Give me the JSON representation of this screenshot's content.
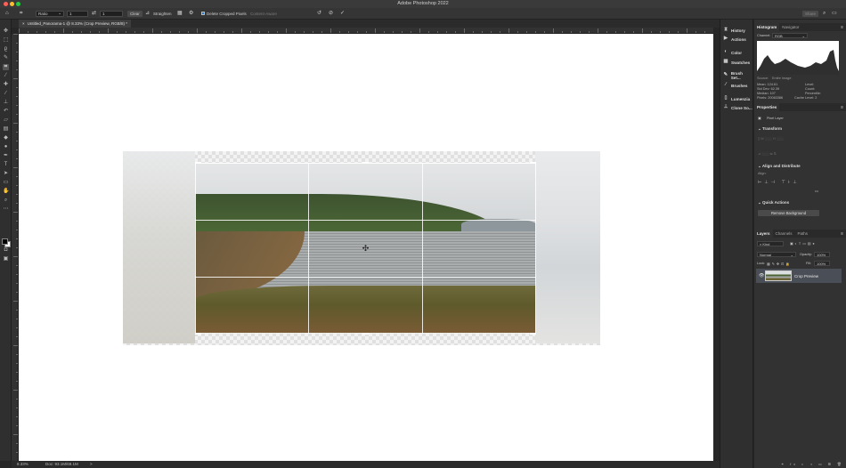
{
  "window": {
    "title": "Adobe Photoshop 2022",
    "traffic_colors": [
      "#fe5f57",
      "#febc2e",
      "#28c840"
    ]
  },
  "options_bar": {
    "ratio_select": "Ratio",
    "width_value": "1",
    "height_value": "1",
    "clear_label": "Clear",
    "straighten_label": "Straighten",
    "delete_cropped_label": "Delete Cropped Pixels",
    "content_aware_label": "Content-Aware",
    "share_label": "Share"
  },
  "document": {
    "tab_title": "Untitled_Panorama-1 @ 8.33% (Crop Preview, RGB/8) *"
  },
  "status": {
    "zoom": "8.33%",
    "doc_size": "Doc: 93.1M/69.1M",
    "arrow": ">"
  },
  "side_icons": {
    "items": [
      {
        "icon": "history-icon",
        "label": "History"
      },
      {
        "icon": "actions-icon",
        "label": "Actions"
      },
      {
        "icon": "color-icon",
        "label": "Color"
      },
      {
        "icon": "swatches-icon",
        "label": "Swatches"
      },
      {
        "icon": "brush-settings-icon",
        "label": "Brush Set..."
      },
      {
        "icon": "brushes-icon",
        "label": "Brushes"
      },
      {
        "icon": "lumenzia-icon",
        "label": "Lumenzia"
      },
      {
        "icon": "clone-source-icon",
        "label": "Clone So..."
      }
    ]
  },
  "histogram": {
    "tabs": [
      "Histogram",
      "Navigator"
    ],
    "channel_label": "Channel:",
    "channel_value": "RGB",
    "source_label": "Source:",
    "source_value": "Entire Image",
    "stats_left": [
      "Mean: 124.61",
      "Std Dev: 62.39",
      "Median: 107",
      "Pixels: 20063386"
    ],
    "stats_right": [
      "Level:",
      "Count:",
      "Percentile:",
      "Cache Level: 2"
    ]
  },
  "properties": {
    "title": "Properties",
    "layer_kind": "Pixel Layer",
    "transform_title": "Transform",
    "align_title": "Align and Distribute",
    "align_label": "Align:",
    "quick_actions_title": "Quick Actions",
    "remove_bg_label": "Remove Background",
    "more": "•••"
  },
  "layers": {
    "tabs": [
      "Layers",
      "Channels",
      "Paths"
    ],
    "kind_label": "Kind",
    "blend_mode": "Normal",
    "opacity_label": "Opacity:",
    "opacity_value": "100%",
    "lock_label": "Lock:",
    "fill_label": "Fill:",
    "fill_value": "100%",
    "items": [
      {
        "name": "Crop Preview",
        "visible": true
      }
    ]
  }
}
